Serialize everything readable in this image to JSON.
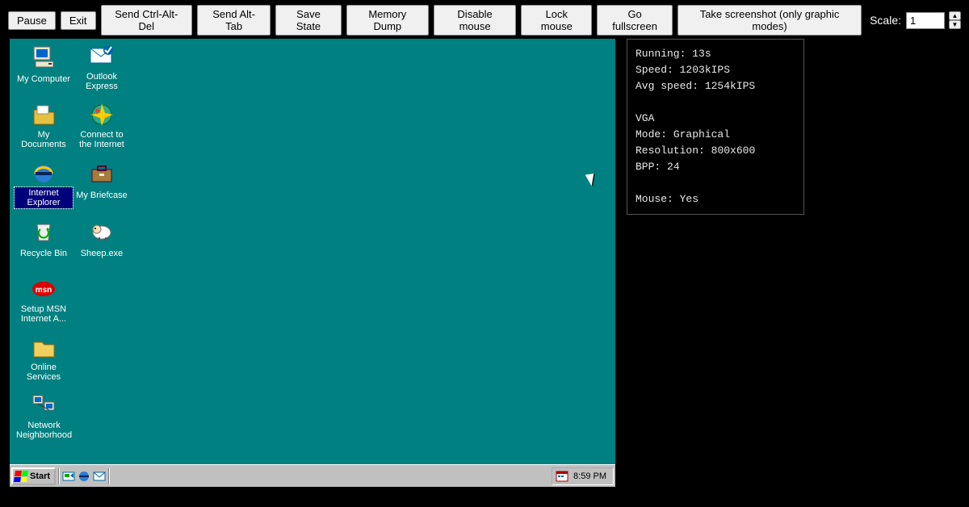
{
  "toolbar": {
    "buttons": [
      "Pause",
      "Exit",
      "Send Ctrl-Alt-Del",
      "Send Alt-Tab",
      "Save State",
      "Memory Dump",
      "Disable mouse",
      "Lock mouse",
      "Go fullscreen",
      "Take screenshot (only graphic modes)"
    ],
    "scale_label": "Scale:",
    "scale_value": "1"
  },
  "desktop": {
    "icons": [
      {
        "label": "My Computer",
        "col": 0,
        "row": 0,
        "icon": "computer"
      },
      {
        "label": "Outlook Express",
        "col": 1,
        "row": 0,
        "icon": "outlook"
      },
      {
        "label": "My Documents",
        "col": 0,
        "row": 1,
        "icon": "docs"
      },
      {
        "label": "Connect to the Internet",
        "col": 1,
        "row": 1,
        "icon": "connect"
      },
      {
        "label": "Internet Explorer",
        "col": 0,
        "row": 2,
        "icon": "ie",
        "selected": true
      },
      {
        "label": "My Briefcase",
        "col": 1,
        "row": 2,
        "icon": "briefcase"
      },
      {
        "label": "Recycle Bin",
        "col": 0,
        "row": 3,
        "icon": "recycle"
      },
      {
        "label": "Sheep.exe",
        "col": 1,
        "row": 3,
        "icon": "sheep"
      },
      {
        "label": "Setup MSN Internet A...",
        "col": 0,
        "row": 4,
        "icon": "msn"
      },
      {
        "label": "Online Services",
        "col": 0,
        "row": 5,
        "icon": "folder"
      },
      {
        "label": "Network Neighborhood",
        "col": 0,
        "row": 6,
        "icon": "network"
      }
    ],
    "taskbar": {
      "start_label": "Start",
      "clock": "8:59 PM"
    }
  },
  "stats": {
    "running_label": "Running:",
    "running_value": "13s",
    "speed_label": "Speed:",
    "speed_value": "1203kIPS",
    "avg_label": "Avg speed:",
    "avg_value": "1254kIPS",
    "vga_header": "VGA",
    "mode_label": "Mode:",
    "mode_value": "Graphical",
    "res_label": "Resolution:",
    "res_value": "800x600",
    "bpp_label": "BPP:",
    "bpp_value": "24",
    "mouse_label": "Mouse:",
    "mouse_value": "Yes"
  }
}
